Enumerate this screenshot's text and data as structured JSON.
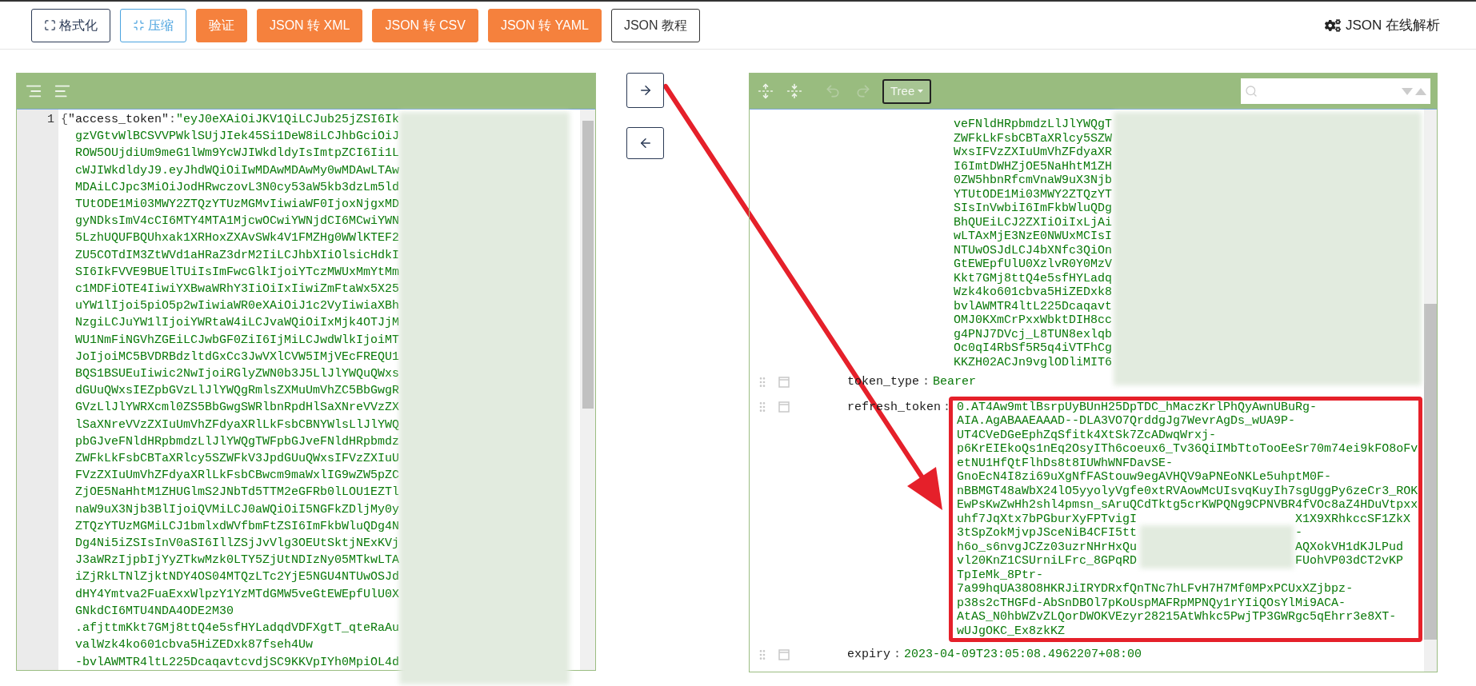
{
  "toolbar": {
    "buttons": [
      {
        "label": "格式化",
        "kind": "format"
      },
      {
        "label": "压缩",
        "kind": "compress"
      },
      {
        "label": "验证",
        "kind": "action"
      },
      {
        "label": "JSON 转 XML",
        "kind": "action"
      },
      {
        "label": "JSON 转 CSV",
        "kind": "action"
      },
      {
        "label": "JSON 转 YAML",
        "kind": "action"
      },
      {
        "label": "JSON 教程",
        "kind": "plain"
      }
    ],
    "brand": "JSON 在线解析"
  },
  "editor": {
    "line_number": "1",
    "open_brace": "{",
    "key": "\"access_token\"",
    "colon": ":",
    "lines": [
      "\"eyJ0eXAiOiJKV1QiLCJub25jZSI6Ik",
      "gzVGtvWlBCSVVPWklSUjJIek45Si1DeW8iLCJhbGciOiJ",
      "ROW5OUjdiUm9meG1lWm9YcWJIWkdldyIsImtpZCI6Ii1L",
      "cWJIWkdldyJ9.eyJhdWQiOiIwMDAwMDAwMy0wMDAwLTAw",
      "MDAiLCJpc3MiOiJodHRwczovL3N0cy53aW5kb3dzLm5ld",
      "TUtODE1Mi03MWY2ZTQzYTUzMGMvIiwiaWF0IjoxNjgxMD",
      "gyNDksImV4cCI6MTY4MTA1MjcwOCwiYWNjdCI6MCwiYWN",
      "5LzhUQUFBQUhxak1XRHoxZXAvSWk4V1FMZHg0WWlKTEF2",
      "ZU5COTdIM3ZtWVd1aHRaZ3drM2IiLCJhbXIiOlsicHdkI",
      "SI6IkFVVE9BUElTUiIsImFwcGlkIjoiYTczMWUxMmYtMm",
      "c1MDFiOTE4IiwiYXBwaWRhY3IiOiIxIiwiZmFtaWx5X25",
      "uYW1lIjoi5piO5p2wIiwiaWR0eXAiOiJ1c2VyIiwiaXBh",
      "NzgiLCJuYW1lIjoiYWRtaW4iLCJvaWQiOiIxMjk4OTJjM",
      "WU1NmFiNGVhZGEiLCJwbGF0ZiI6IjMiLCJwdWlkIjoiMT",
      "JoIjoiMC5BVDRBdzltdGxCc3JwVXlCVW5IMjVEcFREQU1",
      "BQS1BSUEuIiwic2NwIjoiRGlyZWN0b3J5LlJlYWQuQWxs",
      "dGUuQWxsIEZpbGVzLlJlYWQgRmlsZXMuUmVhZC5BbGwgR",
      "GVzLlJlYWRXcml0ZS5BbGwgSWRlbnRpdHlSaXNreVVzZX",
      "lSaXNreVVzZXIuUmVhZFdyaXRlLkFsbCBNYWlsLlJlYWQ",
      "pbGJveFNldHRpbmdzLlJlYWQgTWFpbGJveFNldHRpbmdz",
      "ZWFkLkFsbCBTaXRlcy5SZWFkV3JpdGUuQWxsIFVzZXIuU",
      "FVzZXIuUmVhZFdyaXRlLkFsbCBwcm9maWxlIG9wZW5pZC",
      "ZjOE5NaHhtM1ZHUGlmS2JNbTd5TTM2eGFRb0lLOU1EZTl",
      "naW9uX3Njb3BlIjoiQVMiLCJ0aWQiOiI5NGFkZDljMy0y",
      "ZTQzYTUzMGMiLCJ1bmlxdWVfbmFtZSI6ImFkbWluQDg4N",
      "Dg4Ni5iZSIsInV0aSI6IllZSjJvVlg3OEUtSktjNExKVj",
      "J3aWRzIjpbIjYyZTkwMzk0LTY5ZjUtNDIzNy05MTkwLTA",
      "iZjRkLTNlZjktNDY4OS04MTQzLTc2YjE5NGU4NTUwOSJd",
      "dHY4Ymtva2FuaExxWlpzY1YzMTdGMW5veGtEWEpfUlU0X",
      "GNkdCI6MTU4NDA4ODE2M30",
      ".afjttmKkt7GMj8ttQ4e5sfHYLadqdVDFXgtT_qteRaAu",
      "valWzk4ko601cbva5HiZEDxk87fseh4Uw",
      "-bvlAWMTR4ltL225DcaqavtcvdjSC9KKVpIYh0MpiOL4d"
    ]
  },
  "tree": {
    "mode": "Tree",
    "rows": [
      {
        "kind": "continuation",
        "lines": [
          "veFNldHRpbmdzLlJlYWQgT",
          "ZWFkLkFsbCBTaXRlcy5SZW",
          "WxsIFVzZXIuUmVhZFdyaXR",
          "I6ImtDWHZjOE5NaHhtM1ZH",
          "0ZW5hbnRfcmVnaW9uX3Njb",
          "YTUtODE1Mi03MWY2ZTQzYT",
          "SIsInVwbiI6ImFkbWluQDg",
          "BhQUEiLCJ2ZXIiOiIxLjAi",
          "wLTAxMjE3NzE0NWUxMCIsI",
          "NTUwOSJdLCJ4bXNfc3QiOn",
          "GtEWEpfUlU0XzlvR0Y0MzV",
          "Kkt7GMj8ttQ4e5sfHYLadq",
          "Wzk4ko601cbva5HiZEDxk8",
          "bvlAWMTR4ltL225Dcaqavt",
          "OMJ0KXmCrPxxWbktDIH8cc",
          "g4PNJ7DVcj_L8TUN8exlqb",
          "Oc0qI4RbSf5R5q4iVTFhCg",
          "KKZH02ACJn9vglODliMIT6"
        ]
      },
      {
        "kind": "field",
        "key": "token_type",
        "colon": ":",
        "value": "Bearer"
      },
      {
        "kind": "block",
        "key": "refresh_token",
        "colon": ":",
        "highlighted": true,
        "lines": [
          "0.AT4Aw9mtlBsrpUyBUnH25DpTDC_hMaczKrlPhQyAwnUBuRg-",
          "AIA.AgABAAEAAAD--DLA3VO7QrddgJg7WevrAgDs_wUA9P-",
          "UT4CVeDGeEphZqSfitk4XtSk7ZcADwqWrxj-",
          "p6KrEIEkoQs1nEq2OsyITh6coeux6_Tv36QiIMbTtoTooEeSr70m74ei9kFO8oFv",
          "etNU1HfQtFlhDs8t8IUWhWNFDavSE-",
          "GnoEcN4I8zi69uXgNfFAStouw9egAVHQV9aPNEoNKLe5uhptM0F-",
          "nBBMGT48aWbX24lO5yyolyVgfe0xtRVAowMcUIsvqKuyIh7sgUggPy6zeCr3_ROK",
          "EwPsKwZwHh2shl4pmsn_sAruQCdTktg5crKWPQNg9CPNVBR4fVOc8aZ4HDuVtpxx",
          [
            "uhf7JqXtx7bPGburXyFPTvigI",
            "X1X9XRhkccSF1ZkX"
          ],
          [
            "3tSpZokMjvpJSceNiB4CFI5tt",
            "-"
          ],
          [
            "h6o_s6nvgJCZz03uzrNHrHxQu",
            "AQXokVH1dKJLPud"
          ],
          [
            "vl20KnZ1CSUrniLFrc_8GPqRD",
            "FUohVP03dCT2vKP"
          ],
          "TpIeMk_8Ptr-",
          "7a99hqUA38O8HKRJiIRYDRxfQnTNc7hLFvH7H7Mf0MPxPCUxXZjbpz-",
          "p38s2cTHGFd-AbSnDBOl7pKoUspMAFRpMPNQy1rYIiQOsYlMi9ACA-",
          "AtAS_N0hbWZvZLQorDWOKVEzyr28215AtWhkc5PwjTP3GWRgc5qEhrr3e8XT-",
          "wUJgOKC_Ex8zkKZ"
        ]
      },
      {
        "kind": "field",
        "key": "expiry",
        "colon": ":",
        "value": "2023-04-09T23:05:08.4962207+08:00"
      }
    ]
  }
}
